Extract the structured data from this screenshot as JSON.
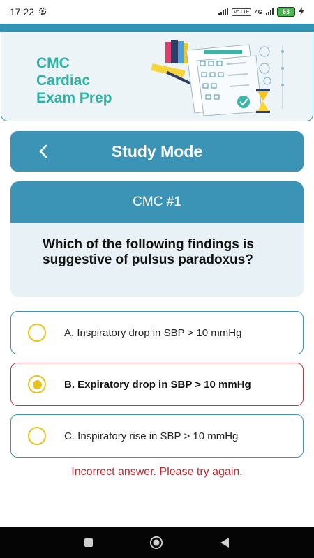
{
  "status_bar": {
    "time": "17:22",
    "battery": "63",
    "network_label": "4G",
    "volte_label": "Vo LTE"
  },
  "header": {
    "app_title": "CMC\nCardiac\nExam Prep"
  },
  "titlebar": {
    "title": "Study Mode",
    "back_icon": "chevron-left-icon"
  },
  "question": {
    "number": "CMC #1",
    "text": "Which of the following findings is suggestive of pulsus paradoxus?"
  },
  "options": [
    {
      "label": "A. Inspiratory drop in SBP > 10 mmHg",
      "selected": false
    },
    {
      "label": "B. Expiratory drop in SBP > 10 mmHg",
      "selected": true
    },
    {
      "label": "C. Inspiratory rise in SBP > 10 mmHg",
      "selected": false
    }
  ],
  "feedback": "Incorrect answer. Please try again.",
  "colors": {
    "primary": "#3b93b6",
    "accent_title": "#2bb3a3",
    "radio": "#e8c21c",
    "error": "#c0272d"
  },
  "nav": {
    "recents_icon": "square-icon",
    "home_icon": "circle-icon",
    "back_icon": "triangle-back-icon"
  }
}
